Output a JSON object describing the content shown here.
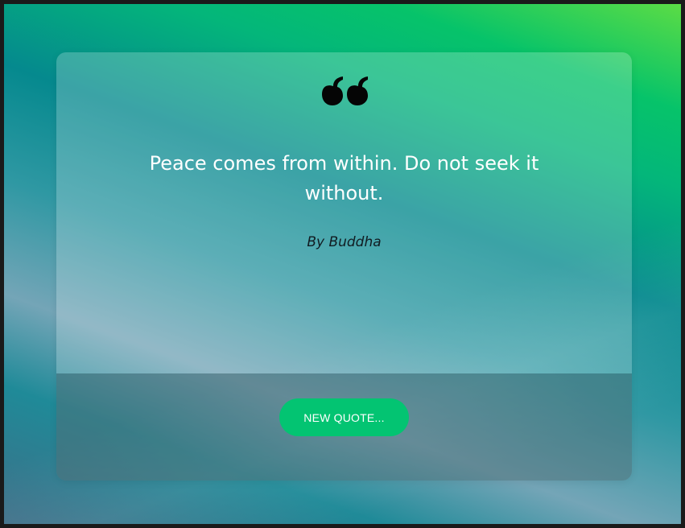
{
  "quote": {
    "icon": "quote-left-icon",
    "text": "Peace comes from within. Do not seek it without.",
    "author": "By Buddha"
  },
  "actions": {
    "new_quote_label": "NEW QUOTE..."
  },
  "colors": {
    "button": "#03c472",
    "quote_text": "#ffffff",
    "author_text": "#111c22",
    "background_start": "#5bdc45",
    "background_mid": "#05898e",
    "background_end": "#3f6f88"
  }
}
